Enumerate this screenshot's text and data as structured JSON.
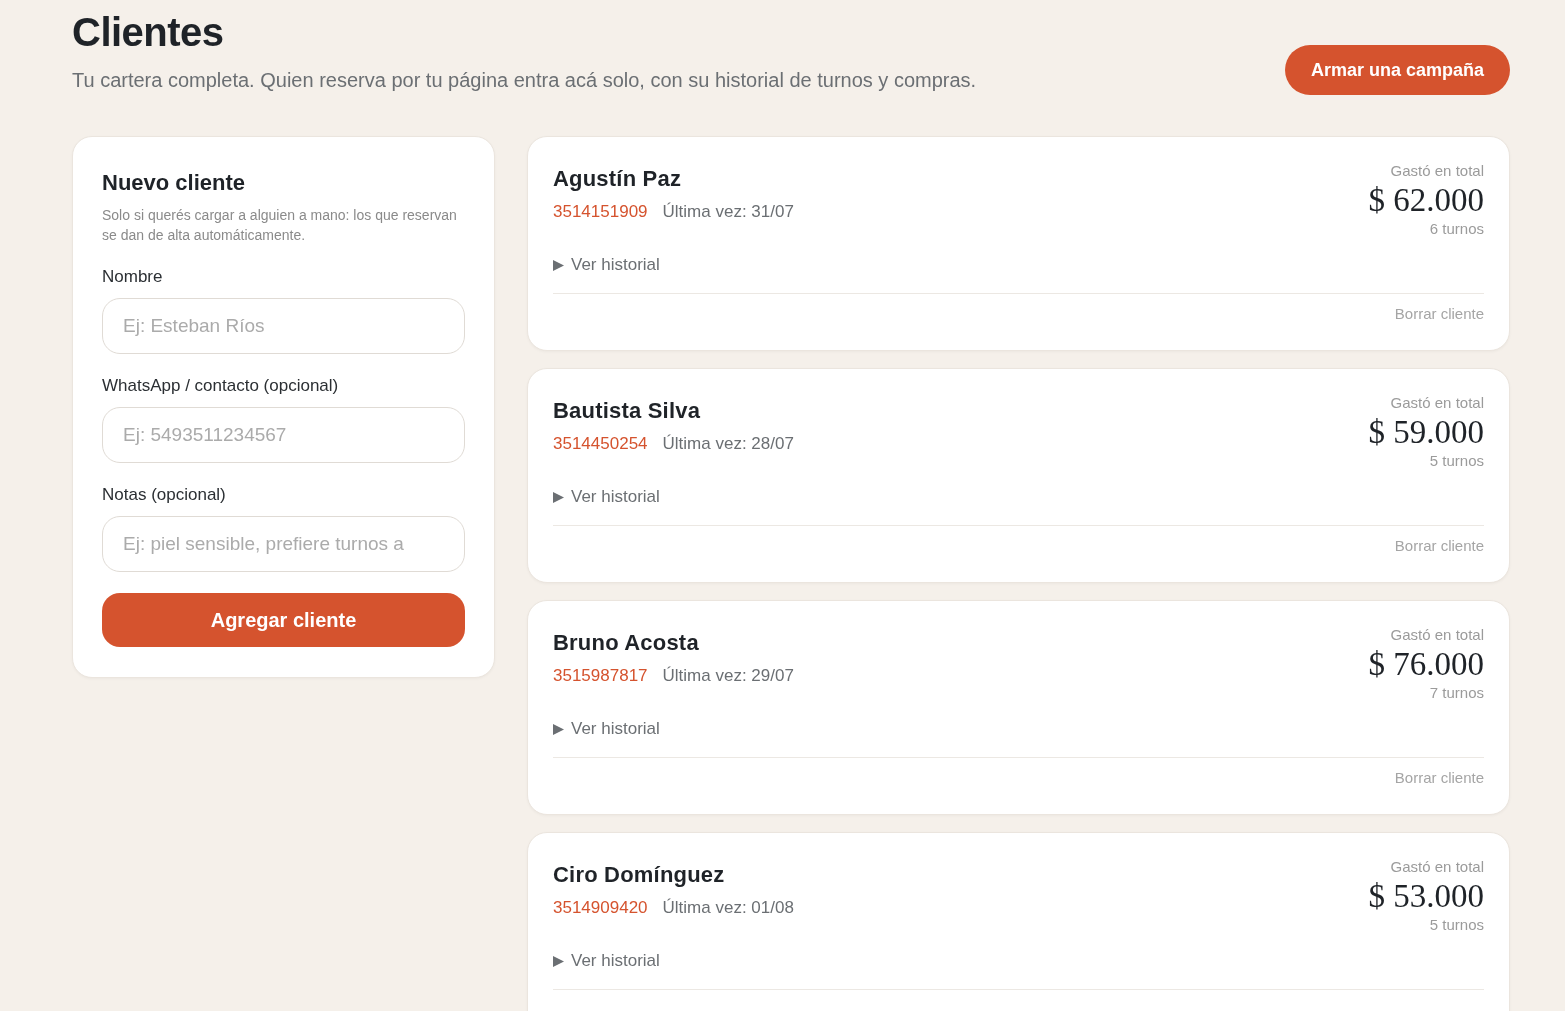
{
  "header": {
    "title": "Clientes",
    "subtitle": "Tu cartera completa. Quien reserva por tu página entra acá solo, con su historial de turnos y compras.",
    "action_button": "Armar una campaña"
  },
  "new_client_form": {
    "title": "Nuevo cliente",
    "description": "Solo si querés cargar a alguien a mano: los que reservan se dan de alta automáticamente.",
    "fields": [
      {
        "label": "Nombre",
        "placeholder": "Ej: Esteban Ríos"
      },
      {
        "label": "WhatsApp / contacto (opcional)",
        "placeholder": "Ej: 5493511234567"
      },
      {
        "label": "Notas (opcional)",
        "placeholder": "Ej: piel sensible, prefiere turnos a"
      }
    ],
    "submit_button": "Agregar cliente"
  },
  "clients": [
    {
      "name": "Agustín Paz",
      "phone": "3514151909",
      "last_visit": "Última vez: 31/07",
      "total_label": "Gastó en total",
      "total": "$ 62.000",
      "appointments": "6 turnos",
      "history": {
        "label": "Ver historial",
        "expanded": false
      },
      "delete_link": "Borrar cliente"
    },
    {
      "name": "Bautista Silva",
      "phone": "3514450254",
      "last_visit": "Última vez: 28/07",
      "total_label": "Gastó en total",
      "total": "$ 59.000",
      "appointments": "5 turnos",
      "history": {
        "label": "Ver historial",
        "expanded": false
      },
      "delete_link": "Borrar cliente"
    },
    {
      "name": "Bruno Acosta",
      "phone": "3515987817",
      "last_visit": "Última vez: 29/07",
      "total_label": "Gastó en total",
      "total": "$ 76.000",
      "appointments": "7 turnos",
      "history": {
        "label": "Ver historial",
        "expanded": false
      },
      "delete_link": "Borrar cliente"
    },
    {
      "name": "Ciro Domínguez",
      "phone": "3514909420",
      "last_visit": "Última vez: 01/08",
      "total_label": "Gastó en total",
      "total": "$ 53.000",
      "appointments": "5 turnos",
      "history": {
        "label": "Ver historial",
        "expanded": false
      }
    }
  ]
}
